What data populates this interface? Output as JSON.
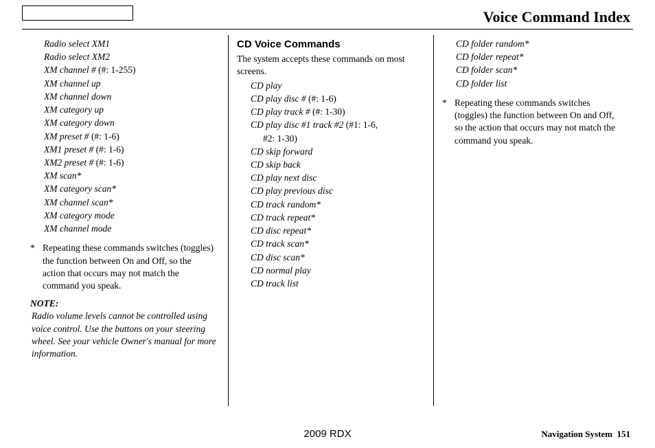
{
  "title": "Voice Command Index",
  "col1": {
    "commands": [
      {
        "ital": "Radio select XM1",
        "rest": ""
      },
      {
        "ital": "Radio select XM2",
        "rest": ""
      },
      {
        "ital": "XM channel #",
        "rest": " (#: 1-255)"
      },
      {
        "ital": "XM channel up",
        "rest": ""
      },
      {
        "ital": "XM channel down",
        "rest": ""
      },
      {
        "ital": "XM category up",
        "rest": ""
      },
      {
        "ital": "XM category down",
        "rest": ""
      },
      {
        "ital": "XM preset #",
        "rest": " (#: 1-6)"
      },
      {
        "ital": "XM1 preset #",
        "rest": " (#: 1-6)"
      },
      {
        "ital": "XM2 preset #",
        "rest": " (#: 1-6)"
      },
      {
        "ital": "XM scan*",
        "rest": ""
      },
      {
        "ital": "XM category scan*",
        "rest": ""
      },
      {
        "ital": "XM channel scan*",
        "rest": ""
      },
      {
        "ital": "XM category mode",
        "rest": ""
      },
      {
        "ital": "XM channel mode",
        "rest": ""
      }
    ],
    "starnote": "Repeating these commands switches (toggles) the function between On and Off, so the action that occurs may not match the command you speak.",
    "note_head": "NOTE:",
    "note_body": "Radio volume levels cannot be controlled using voice control. Use the buttons on your steering wheel. See your vehicle Owner's manual for more information."
  },
  "col2": {
    "heading": "CD Voice Commands",
    "intro": "The system accepts these commands on most screens.",
    "commands": [
      {
        "ital": "CD play",
        "rest": ""
      },
      {
        "ital": "CD play disc #",
        "rest": " (#: 1-6)"
      },
      {
        "ital": "CD play track #",
        "rest": " (#: 1-30)"
      },
      {
        "ital": "CD play disc #1 track #2",
        "rest": " (#1: 1-6,",
        "wrap": "#2: 1-30)"
      },
      {
        "ital": "CD skip forward",
        "rest": ""
      },
      {
        "ital": "CD skip back",
        "rest": ""
      },
      {
        "ital": "CD play next disc",
        "rest": ""
      },
      {
        "ital": "CD play previous disc",
        "rest": ""
      },
      {
        "ital": "CD track random*",
        "rest": ""
      },
      {
        "ital": "CD track repeat*",
        "rest": ""
      },
      {
        "ital": "CD disc repeat*",
        "rest": ""
      },
      {
        "ital": "CD track scan*",
        "rest": ""
      },
      {
        "ital": "CD disc scan*",
        "rest": ""
      },
      {
        "ital": "CD normal play",
        "rest": ""
      },
      {
        "ital": "CD track list",
        "rest": ""
      }
    ]
  },
  "col3": {
    "commands": [
      {
        "ital": "CD folder random*",
        "rest": ""
      },
      {
        "ital": "CD folder repeat*",
        "rest": ""
      },
      {
        "ital": "CD folder scan*",
        "rest": ""
      },
      {
        "ital": "CD folder list",
        "rest": ""
      }
    ],
    "starnote": "Repeating these commands switches (toggles) the function between On and Off, so the action that occurs may not match the command you speak."
  },
  "footer": {
    "center": "2009  RDX",
    "right_label": "Navigation System",
    "right_page": "151"
  }
}
